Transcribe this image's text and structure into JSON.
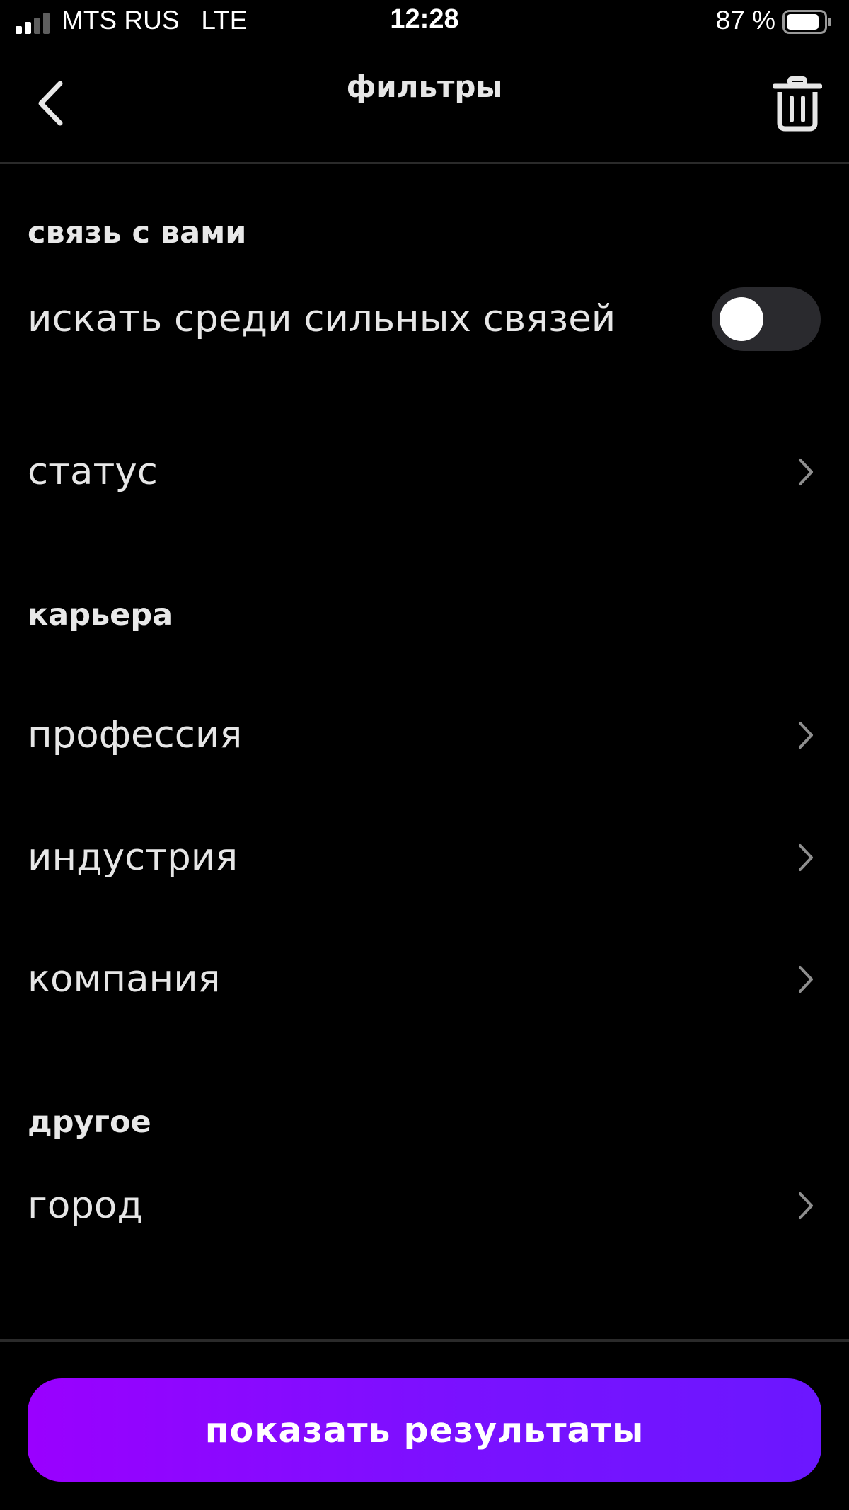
{
  "status_bar": {
    "carrier": "MTS RUS   LTE",
    "time": "12:28",
    "battery_percent": "87 %",
    "battery_level": 0.87,
    "signal_bars_active": 2,
    "signal_bars_total": 4
  },
  "header": {
    "title": "фильтры",
    "back_icon": "chevron-left-icon",
    "delete_icon": "trash-icon"
  },
  "sections": {
    "connection": {
      "title": "связь с вами",
      "strong_ties": {
        "label": "искать среди сильных связей",
        "toggle_on": false
      },
      "status": {
        "label": "статус"
      }
    },
    "career": {
      "title": "карьера",
      "items": [
        {
          "label": "профессия"
        },
        {
          "label": "индустрия"
        },
        {
          "label": "компания"
        }
      ]
    },
    "other": {
      "title": "другое",
      "items": [
        {
          "label": "город"
        }
      ]
    }
  },
  "footer": {
    "show_results_label": "показать результаты"
  },
  "colors": {
    "background": "#000000",
    "accent_start": "#9a00ff",
    "accent_end": "#6b17ff",
    "toggle_track_off": "#2a2a2e"
  }
}
